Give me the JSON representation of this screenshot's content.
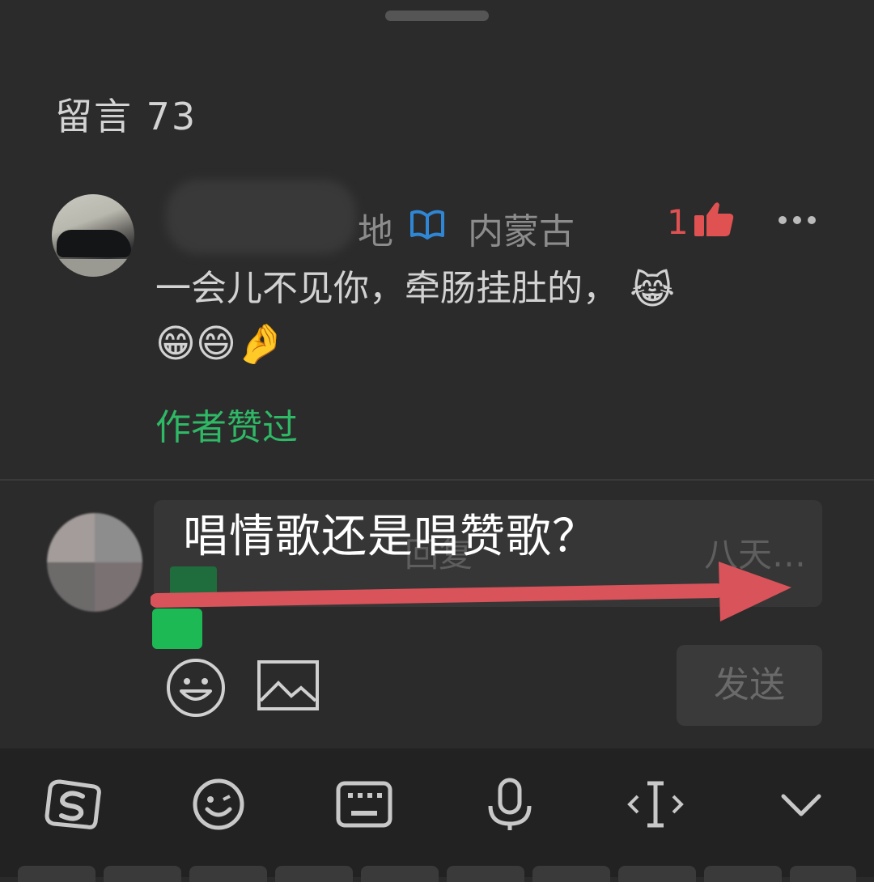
{
  "header": {
    "title": "留言 73"
  },
  "comment": {
    "name_start": "🀫",
    "name_visible_start": "",
    "name_end": "地",
    "location": "内蒙古",
    "likes": "1",
    "text": "一会儿不见你，牵肠挂肚的，",
    "emojis_line1": "😹",
    "emojis_line2": "😁😄🤌",
    "author_liked": "作者赞过"
  },
  "reply": {
    "placeholder": "回复",
    "placeholder_tail": "八天…",
    "send_label": "发送"
  },
  "overlay": {
    "caption": "唱情歌还是唱赞歌？"
  },
  "colors": {
    "accent_green": "#2fb866",
    "like_red": "#e05252",
    "arrow_red": "#d9535a"
  },
  "keyboard_toolbar": {
    "icons": [
      "sogou-logo-icon",
      "emoji-icon",
      "keyboard-icon",
      "microphone-icon",
      "cursor-move-icon",
      "collapse-icon"
    ]
  }
}
